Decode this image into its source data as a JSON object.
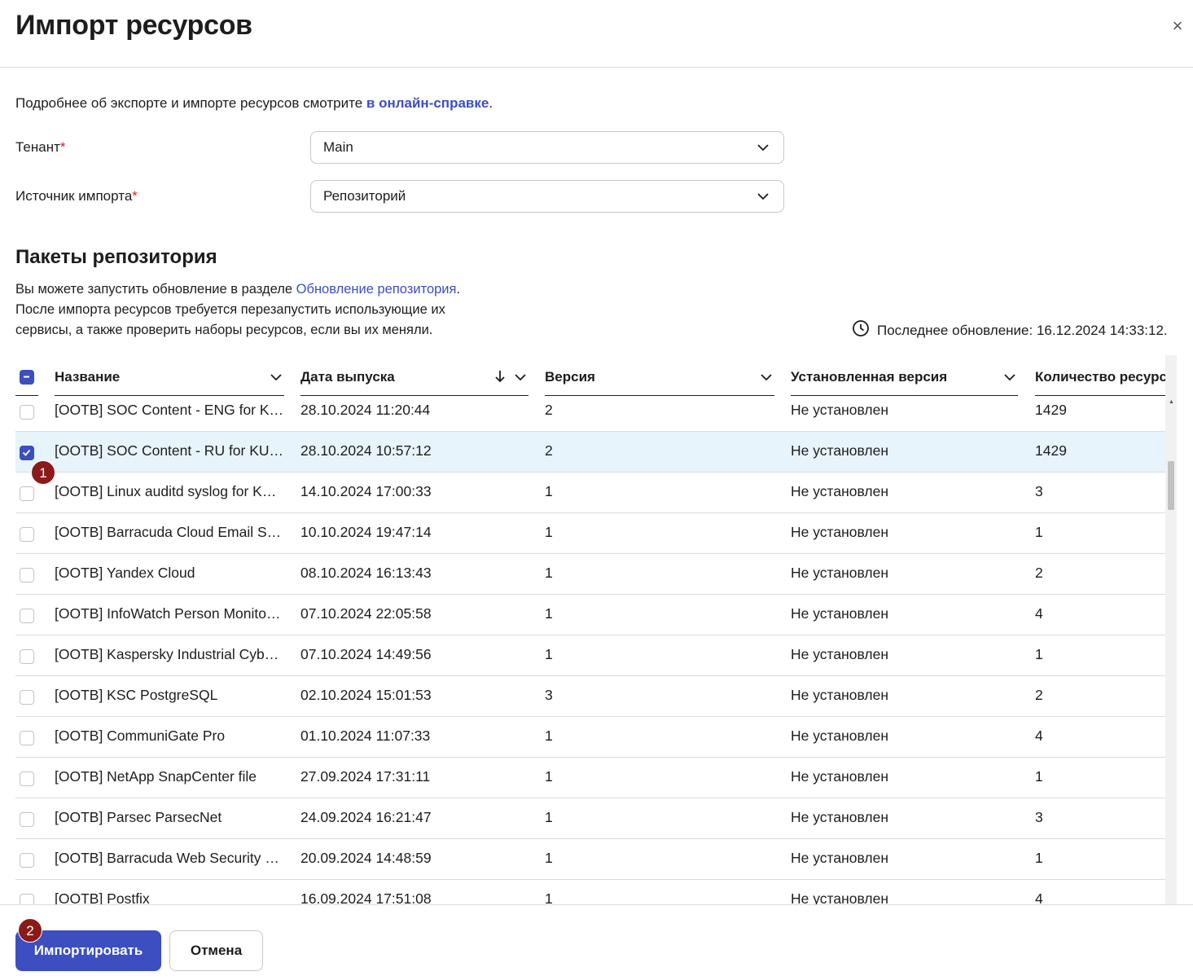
{
  "dialog": {
    "title": "Импорт ресурсов",
    "close_icon": "×"
  },
  "info": {
    "text": "Подробнее об экспорте и импорте ресурсов смотрите ",
    "link": "в онлайн-справке",
    "end": "."
  },
  "form": {
    "tenant_label": "Тенант",
    "tenant_value": "Main",
    "source_label": "Источник импорта",
    "source_value": "Репозиторий",
    "required_mark": "*"
  },
  "packages": {
    "title": "Пакеты репозитория",
    "desc_prefix": "Вы можете запустить обновление в разделе ",
    "desc_link": "Обновление репозитория",
    "desc_suffix": ".",
    "desc_line2": "После импорта ресурсов требуется перезапустить использующие их",
    "desc_line3": "сервисы, а также проверить наборы ресурсов, если вы их меняли.",
    "last_update": "Последнее обновление: 16.12.2024 14:33:12."
  },
  "table": {
    "columns": [
      "Название",
      "Дата выпуска",
      "Версия",
      "Установленная версия",
      "Количество ресурсов"
    ],
    "rows": [
      {
        "name": "[OOTB] SOC Content - ENG for KU...",
        "date": "28.10.2024 11:20:44",
        "version": "2",
        "installed": "Не установлен",
        "count": "1429",
        "checked": false
      },
      {
        "name": "[OOTB] SOC Content - RU for KUM...",
        "date": "28.10.2024 10:57:12",
        "version": "2",
        "installed": "Не установлен",
        "count": "1429",
        "checked": true
      },
      {
        "name": "[OOTB] Linux auditd syslog for KU...",
        "date": "14.10.2024 17:00:33",
        "version": "1",
        "installed": "Не установлен",
        "count": "3",
        "checked": false
      },
      {
        "name": "[OOTB] Barracuda Cloud Email Se...",
        "date": "10.10.2024 19:47:14",
        "version": "1",
        "installed": "Не установлен",
        "count": "1",
        "checked": false
      },
      {
        "name": "[OOTB] Yandex Cloud",
        "date": "08.10.2024 16:13:43",
        "version": "1",
        "installed": "Не установлен",
        "count": "2",
        "checked": false
      },
      {
        "name": "[OOTB] InfoWatch Person Monitor ...",
        "date": "07.10.2024 22:05:58",
        "version": "1",
        "installed": "Не установлен",
        "count": "4",
        "checked": false
      },
      {
        "name": "[OOTB] Kaspersky Industrial Cyber...",
        "date": "07.10.2024 14:49:56",
        "version": "1",
        "installed": "Не установлен",
        "count": "1",
        "checked": false
      },
      {
        "name": "[OOTB] KSC PostgreSQL",
        "date": "02.10.2024 15:01:53",
        "version": "3",
        "installed": "Не установлен",
        "count": "2",
        "checked": false
      },
      {
        "name": "[OOTB] CommuniGate Pro",
        "date": "01.10.2024 11:07:33",
        "version": "1",
        "installed": "Не установлен",
        "count": "4",
        "checked": false
      },
      {
        "name": "[OOTB] NetApp SnapCenter file",
        "date": "27.09.2024 17:31:11",
        "version": "1",
        "installed": "Не установлен",
        "count": "1",
        "checked": false
      },
      {
        "name": "[OOTB] Parsec ParsecNet",
        "date": "24.09.2024 16:21:47",
        "version": "1",
        "installed": "Не установлен",
        "count": "3",
        "checked": false
      },
      {
        "name": "[OOTB] Barracuda Web Security G...",
        "date": "20.09.2024 14:48:59",
        "version": "1",
        "installed": "Не установлен",
        "count": "1",
        "checked": false
      },
      {
        "name": "[OOTB] Postfix",
        "date": "16.09.2024 17:51:08",
        "version": "1",
        "installed": "Не установлен",
        "count": "4",
        "checked": false
      }
    ]
  },
  "footer": {
    "import_button": "Импортировать",
    "cancel_button": "Отмена"
  },
  "badges": {
    "one": "1",
    "two": "2"
  },
  "colors": {
    "accent": "#3c4ec0",
    "selected_row": "#e8f4fb",
    "badge": "#8b1a1a",
    "required": "#d3202f"
  }
}
